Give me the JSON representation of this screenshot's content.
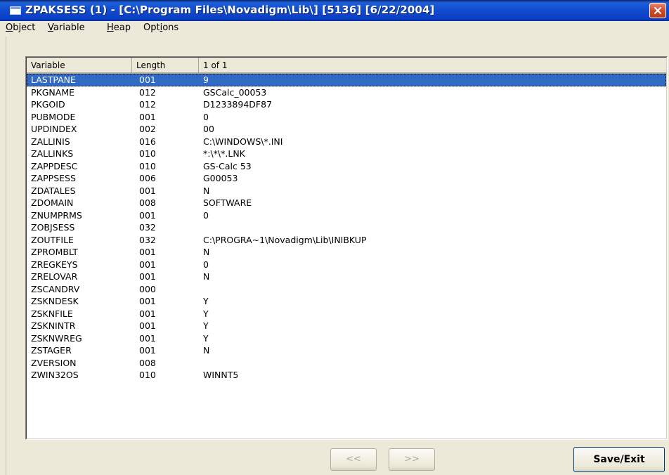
{
  "window": {
    "title": "ZPAKSESS (1) - [C:\\Program Files\\Novadigm\\Lib\\] [5136] [6/22/2004]",
    "icon": "app-window-icon",
    "close_icon": "close-icon"
  },
  "menu": [
    {
      "label": "Object",
      "accel": "O",
      "rest": "bject"
    },
    {
      "label": "Variable",
      "accel": "V",
      "rest": "ariable"
    },
    {
      "label": "Heap",
      "accel": "H",
      "rest": "eap"
    },
    {
      "label": "Options",
      "pre": "Opt",
      "accel": "i",
      "rest": "ons"
    }
  ],
  "table": {
    "columns": [
      "Variable",
      "Length",
      "1 of 1"
    ],
    "selected_index": 0,
    "rows": [
      {
        "variable": "LASTPANE",
        "length": "001",
        "value": "9"
      },
      {
        "variable": "PKGNAME",
        "length": "012",
        "value": "GSCalc_00053"
      },
      {
        "variable": "PKGOID",
        "length": "012",
        "value": "D1233894DF87"
      },
      {
        "variable": "PUBMODE",
        "length": "001",
        "value": "0"
      },
      {
        "variable": "UPDINDEX",
        "length": "002",
        "value": "00"
      },
      {
        "variable": "ZALLINIS",
        "length": "016",
        "value": "C:\\WINDOWS\\*.INI"
      },
      {
        "variable": "ZALLINKS",
        "length": "010",
        "value": "*:\\*\\*.LNK"
      },
      {
        "variable": "ZAPPDESC",
        "length": "010",
        "value": "GS-Calc 53"
      },
      {
        "variable": "ZAPPSESS",
        "length": "006",
        "value": "G00053"
      },
      {
        "variable": "ZDATALES",
        "length": "001",
        "value": "N"
      },
      {
        "variable": "ZDOMAIN",
        "length": "008",
        "value": "SOFTWARE"
      },
      {
        "variable": "ZNUMPRMS",
        "length": "001",
        "value": "0"
      },
      {
        "variable": "ZOBJSESS",
        "length": "032",
        "value": ""
      },
      {
        "variable": "ZOUTFILE",
        "length": "032",
        "value": "C:\\PROGRA~1\\Novadigm\\Lib\\INIBKUP"
      },
      {
        "variable": "ZPROMBLT",
        "length": "001",
        "value": "N"
      },
      {
        "variable": "ZREGKEYS",
        "length": "001",
        "value": "0"
      },
      {
        "variable": "ZRELOVAR",
        "length": "001",
        "value": "N"
      },
      {
        "variable": "ZSCANDRV",
        "length": "000",
        "value": ""
      },
      {
        "variable": "ZSKNDESK",
        "length": "001",
        "value": "Y"
      },
      {
        "variable": "ZSKNFILE",
        "length": "001",
        "value": "Y"
      },
      {
        "variable": "ZSKNINTR",
        "length": "001",
        "value": "Y"
      },
      {
        "variable": "ZSKNWREG",
        "length": "001",
        "value": "Y"
      },
      {
        "variable": "ZSTAGER",
        "length": "001",
        "value": "N"
      },
      {
        "variable": "ZVERSION",
        "length": "008",
        "value": ""
      },
      {
        "variable": "ZWIN32OS",
        "length": "010",
        "value": "WINNT5"
      }
    ]
  },
  "buttons": {
    "prev_label": "<<",
    "next_label": ">>",
    "save_label": "Save/Exit"
  },
  "colors": {
    "selection": "#316ac5",
    "titlebar": "#0f4bd0",
    "face": "#ece9d8"
  }
}
